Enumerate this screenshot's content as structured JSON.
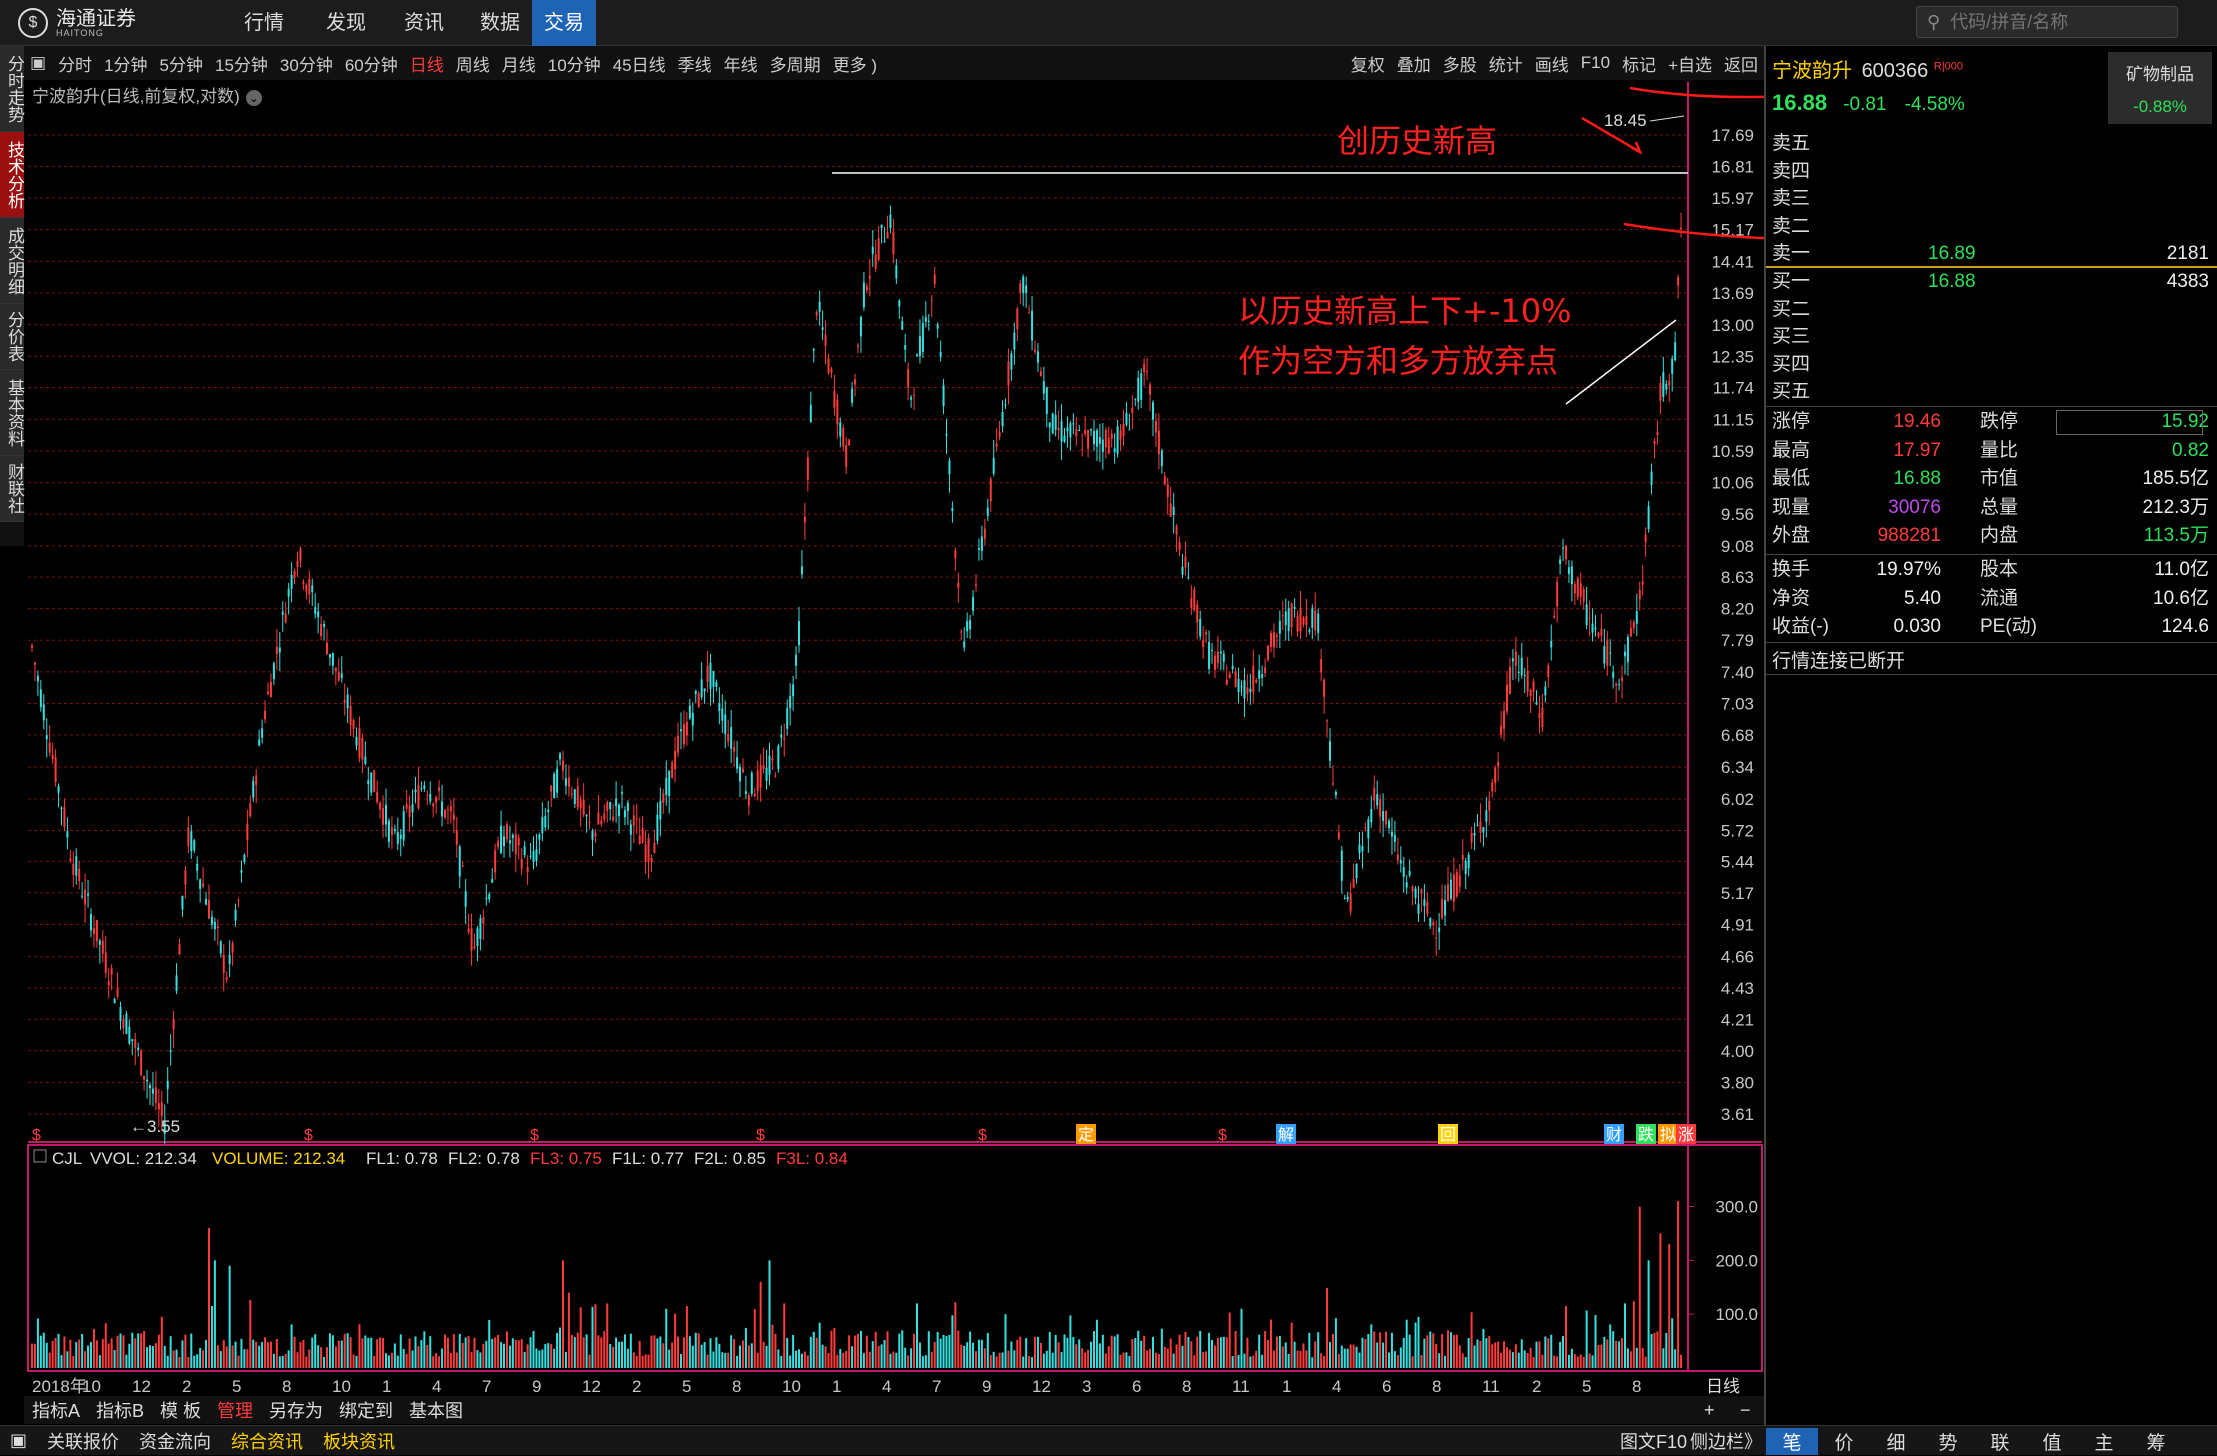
{
  "brand": {
    "name": "海通证券",
    "sub": "HAITONG"
  },
  "nav": [
    {
      "label": "行情"
    },
    {
      "label": "发现"
    },
    {
      "label": "资讯"
    },
    {
      "label": "数据"
    },
    {
      "label": "交易"
    }
  ],
  "search": {
    "placeholder": "代码/拼音/名称"
  },
  "left_tabs": [
    "分时走势",
    "技术分析",
    "成交明细",
    "分价表",
    "基本资料",
    "财联社"
  ],
  "toolbar_left": [
    "分时",
    "1分钟",
    "5分钟",
    "15分钟",
    "30分钟",
    "60分钟",
    "日线",
    "周线",
    "月线",
    "10分钟",
    "45日线",
    "季线",
    "年线",
    "多周期",
    "更多 )"
  ],
  "toolbar_right": [
    "复权",
    "叠加",
    "多股",
    "统计",
    "画线",
    "F10",
    "标记",
    "+自选",
    "返回"
  ],
  "chart": {
    "title": "宁波韵升(日线,前复权,对数)",
    "high_label": "18.45",
    "low_label": "←3.55"
  },
  "annotations": {
    "a1": "创历史新高",
    "a2": "以历史新高上下+-10%",
    "a3": "作为空方和多方放弃点"
  },
  "price_axis": [
    "17.69",
    "16.81",
    "15.97",
    "15.17",
    "14.41",
    "13.69",
    "13.00",
    "12.35",
    "11.74",
    "11.15",
    "10.59",
    "10.06",
    "9.56",
    "9.08",
    "8.63",
    "8.20",
    "7.79",
    "7.40",
    "7.03",
    "6.68",
    "6.34",
    "6.02",
    "5.72",
    "5.44",
    "5.17",
    "4.91",
    "4.66",
    "4.43",
    "4.21",
    "4.00",
    "3.80",
    "3.61"
  ],
  "event_markers": [
    "$",
    "$",
    "$",
    "$",
    "$",
    "定",
    "$",
    "解",
    "回",
    "财",
    "跌",
    "拟",
    "涨"
  ],
  "volume": {
    "header": {
      "cjl": "CJL",
      "vvol": "VVOL: 212.34",
      "volume": "VOLUME: 212.34",
      "fl1": "FL1: 0.78",
      "fl2": "FL2: 0.78",
      "fl3": "FL3: 0.75",
      "f1l": "F1L: 0.77",
      "f2l": "F2L: 0.85",
      "f3l": "F3L: 0.84"
    },
    "axis": [
      "300.0",
      "200.0",
      "100.0"
    ]
  },
  "time_axis": [
    "2018年",
    "10",
    "12",
    "2",
    "5",
    "8",
    "10",
    "1",
    "4",
    "7",
    "9",
    "12",
    "2",
    "5",
    "8",
    "10",
    "1",
    "4",
    "7",
    "9",
    "12",
    "3",
    "6",
    "8",
    "11",
    "1",
    "4",
    "6",
    "8",
    "11",
    "2",
    "5",
    "8"
  ],
  "period_label": "日线",
  "bottom_tabs": [
    "指标A",
    "指标B",
    "模 板",
    "管理",
    "另存为",
    "绑定到",
    "基本图"
  ],
  "bottom_controls": {
    "plus": "+",
    "minus": "−"
  },
  "stock": {
    "name": "宁波韵升",
    "code": "600366",
    "flag": "R|000",
    "price": "16.88",
    "change": "-0.81",
    "pct": "-4.58%",
    "sector": "矿物制品",
    "sector_pct": "-0.88%"
  },
  "asks": [
    {
      "label": "卖五",
      "price": "",
      "vol": ""
    },
    {
      "label": "卖四",
      "price": "",
      "vol": ""
    },
    {
      "label": "卖三",
      "price": "",
      "vol": ""
    },
    {
      "label": "卖二",
      "price": "",
      "vol": ""
    },
    {
      "label": "卖一",
      "price": "16.89",
      "vol": "2181"
    }
  ],
  "bids": [
    {
      "label": "买一",
      "price": "16.88",
      "vol": "4383"
    },
    {
      "label": "买二",
      "price": "",
      "vol": ""
    },
    {
      "label": "买三",
      "price": "",
      "vol": ""
    },
    {
      "label": "买四",
      "price": "",
      "vol": ""
    },
    {
      "label": "买五",
      "price": "",
      "vol": ""
    }
  ],
  "stats": [
    {
      "l1": "涨停",
      "v1": "19.46",
      "c1": "red",
      "l2": "跌停",
      "v2": "15.92",
      "c2": "green"
    },
    {
      "l1": "最高",
      "v1": "17.97",
      "c1": "red",
      "l2": "量比",
      "v2": "0.82",
      "c2": "green"
    },
    {
      "l1": "最低",
      "v1": "16.88",
      "c1": "green",
      "l2": "市值",
      "v2": "185.5亿",
      "c2": "white"
    },
    {
      "l1": "现量",
      "v1": "30076",
      "c1": "purple",
      "l2": "总量",
      "v2": "212.3万",
      "c2": "white"
    },
    {
      "l1": "外盘",
      "v1": "988281",
      "c1": "red",
      "l2": "内盘",
      "v2": "113.5万",
      "c2": "green"
    }
  ],
  "stats2": [
    {
      "l1": "换手",
      "v1": "19.97%",
      "l2": "股本",
      "v2": "11.0亿"
    },
    {
      "l1": "净资",
      "v1": "5.40",
      "l2": "流通",
      "v2": "10.6亿"
    },
    {
      "l1": "收益(-)",
      "v1": "0.030",
      "l2": "PE(动)",
      "v2": "124.6"
    }
  ],
  "conn_status": "行情连接已断开",
  "status_left": [
    "关联报价",
    "资金流向",
    "综合资讯",
    "板块资讯"
  ],
  "status_right": [
    "图文F10",
    "侧边栏》"
  ],
  "right_tabs": [
    "笔",
    "价",
    "细",
    "势",
    "联",
    "值",
    "主",
    "筹"
  ],
  "colors": {
    "up": "#ff3b3b",
    "down": "#35e0e0",
    "accent": "#1f63b5",
    "grid": "#7a1010"
  }
}
